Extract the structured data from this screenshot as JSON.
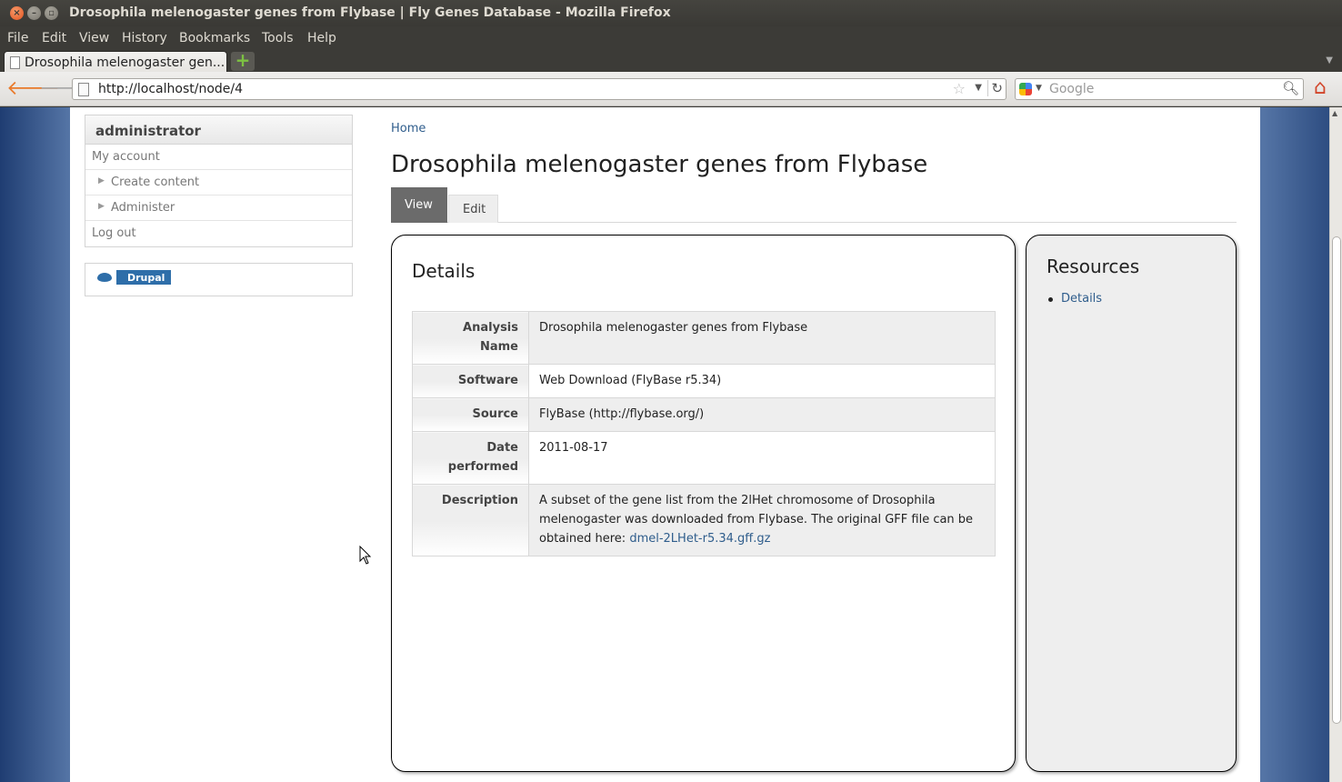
{
  "window": {
    "title": "Drosophila melenogaster genes from Flybase | Fly Genes Database - Mozilla Firefox"
  },
  "menu": [
    "File",
    "Edit",
    "View",
    "History",
    "Bookmarks",
    "Tools",
    "Help"
  ],
  "tab": {
    "title": "Drosophila melenogaster gen..."
  },
  "nav": {
    "url": "http://localhost/node/4",
    "search_placeholder": "Google"
  },
  "sidebar": {
    "heading": "administrator",
    "items": [
      {
        "label": "My account"
      },
      {
        "label": "Create content"
      },
      {
        "label": "Administer"
      },
      {
        "label": "Log out"
      }
    ],
    "badge_label": "Drupal"
  },
  "content": {
    "breadcrumb": "Home",
    "title": "Drosophila melenogaster genes from Flybase",
    "tabs": [
      "View",
      "Edit"
    ],
    "details": {
      "heading": "Details",
      "rows": [
        {
          "label": "Analysis Name",
          "value": "Drosophila melenogaster genes from Flybase"
        },
        {
          "label": "Software",
          "value": "Web Download (FlyBase r5.34)"
        },
        {
          "label": "Source",
          "value": "FlyBase (http://flybase.org/)"
        },
        {
          "label": "Date performed",
          "value": "2011-08-17"
        },
        {
          "label": "Description",
          "value": "A subset of the gene list from the 2lHet chromosome of Drosophila melenogaster was downloaded from Flybase. The original GFF file can be obtained here: ",
          "link": "dmel-2LHet-r5.34.gff.gz"
        }
      ]
    },
    "resources": {
      "heading": "Resources",
      "items": [
        "Details"
      ]
    }
  },
  "colors": {
    "link": "#2f5d8c",
    "active_tab": "#6b6b6b",
    "panel_bg": "#eeeeee"
  }
}
